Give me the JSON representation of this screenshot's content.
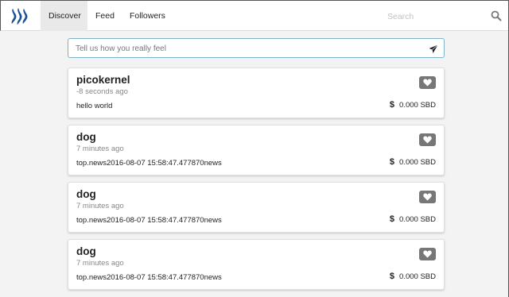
{
  "nav": {
    "tabs": [
      {
        "label": "Discover",
        "active": true
      },
      {
        "label": "Feed",
        "active": false
      },
      {
        "label": "Followers",
        "active": false
      }
    ],
    "search_placeholder": "Search"
  },
  "compose": {
    "placeholder": "Tell us how you really feel"
  },
  "posts": [
    {
      "author": "picokernel",
      "time": "-8 seconds ago",
      "body": "hello world",
      "currency": "$",
      "amount": "0.000 SBD"
    },
    {
      "author": "dog",
      "time": "7 minutes ago",
      "body": "top.news2016-08-07 15:58:47.477870news",
      "currency": "$",
      "amount": "0.000 SBD"
    },
    {
      "author": "dog",
      "time": "7 minutes ago",
      "body": "top.news2016-08-07 15:58:47.477870news",
      "currency": "$",
      "amount": "0.000 SBD"
    },
    {
      "author": "dog",
      "time": "7 minutes ago",
      "body": "top.news2016-08-07 15:58:47.477870news",
      "currency": "$",
      "amount": "0.000 SBD"
    }
  ],
  "icons": {
    "logo": "steem-logo-icon",
    "search": "search-icon",
    "send": "send-icon",
    "like": "heart-icon",
    "currency": "dollar-icon"
  },
  "colors": {
    "logo_blue": "#1a5099",
    "active_tab_bg": "#e9e9e9",
    "compose_border": "#7fb3c9",
    "like_button_bg": "#777777"
  }
}
